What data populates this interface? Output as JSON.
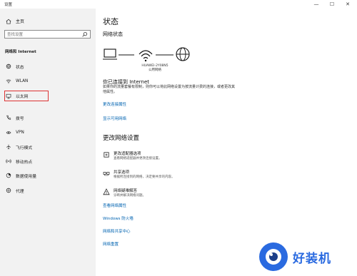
{
  "app": {
    "title": "设置"
  },
  "window_controls": {
    "minimize": "—",
    "maximize": "☐",
    "close": "✕"
  },
  "sidebar": {
    "home_label": "主页",
    "search_placeholder": "查找设置",
    "section_title": "网络和 Internet",
    "items": [
      {
        "label": "状态",
        "icon": "status-icon"
      },
      {
        "label": "WLAN",
        "icon": "wifi-icon"
      },
      {
        "label": "以太网",
        "icon": "ethernet-icon",
        "selected": true
      },
      {
        "label": "拨号",
        "icon": "dialup-icon"
      },
      {
        "label": "VPN",
        "icon": "vpn-icon"
      },
      {
        "label": "飞行模式",
        "icon": "airplane-icon"
      },
      {
        "label": "移动热点",
        "icon": "hotspot-icon"
      },
      {
        "label": "数据使用量",
        "icon": "data-usage-icon"
      },
      {
        "label": "代理",
        "icon": "proxy-icon"
      }
    ]
  },
  "main": {
    "title": "状态",
    "network_status_title": "网络状态",
    "network_name": "HUAWEI-2Y08N5",
    "network_type": "公用网络",
    "connected_title": "你已连接到 Internet",
    "connected_desc": "如果你的流量套餐有限制，则你可以将此网络设置为按流量计费的连接，或者更改其他属性。",
    "link_change_props": "更改连接属性",
    "link_show_networks": "显示可用网络",
    "change_settings_title": "更改网络设置",
    "options": [
      {
        "title": "更改适配器选项",
        "desc": "查看网络适配器并更改连接设置。",
        "icon": "adapter-icon"
      },
      {
        "title": "共享选项",
        "desc": "根据所连接到的网络，决定要共享的内容。",
        "icon": "sharing-icon"
      },
      {
        "title": "网络疑难解答",
        "desc": "诊断并解决网络问题。",
        "icon": "troubleshoot-icon"
      }
    ],
    "bottom_links": [
      "查看网络属性",
      "Windows 防火墙",
      "网络和共享中心",
      "网络重置"
    ]
  },
  "watermark": {
    "text": "好装机"
  },
  "colors": {
    "link": "#0063b1",
    "sidebar_bg": "#f2f2f2",
    "highlight": "#dd3333",
    "watermark": "#2a6ae0"
  }
}
